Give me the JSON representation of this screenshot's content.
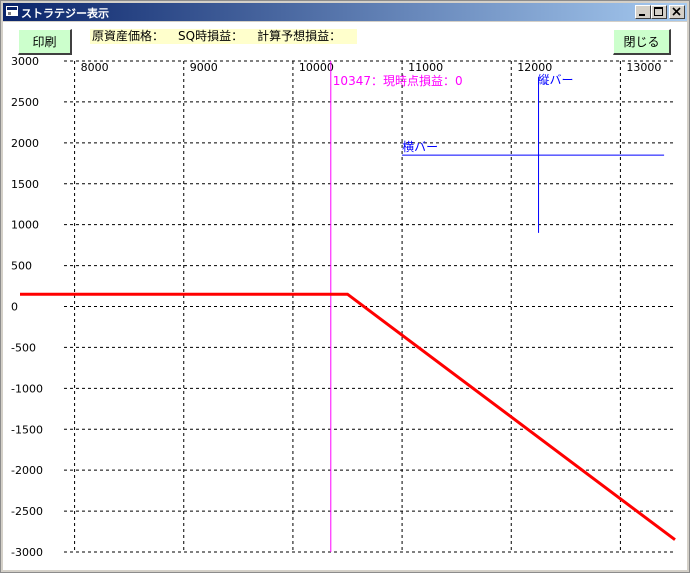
{
  "window": {
    "title": "ストラテジー表示"
  },
  "toolbar": {
    "print_label": "印刷",
    "close_label": "閉じる"
  },
  "info": {
    "underlying_price_label": "原資産価格：",
    "sq_pl_label": "SQ時損益：",
    "calc_expected_pl_label": "計算予想損益："
  },
  "annotations": {
    "current_pl": "10347：現時点損益：0",
    "vertical_bar_label": "縦バー",
    "horizontal_bar_label": "横バー"
  },
  "colors": {
    "payoff": "#ff0000",
    "current_line": "#ff00ff",
    "cursor": "#0000ff",
    "button_bg": "#ccffcc",
    "info_bg": "#ffffcc"
  },
  "chart_data": {
    "type": "line",
    "title": "",
    "xlabel": "",
    "ylabel": "",
    "xlim": [
      7500,
      13500
    ],
    "ylim": [
      -3000,
      3000
    ],
    "grid": true,
    "x_ticks": [
      8000,
      9000,
      10000,
      11000,
      12000,
      13000
    ],
    "y_ticks": [
      3000,
      2500,
      2000,
      1500,
      1000,
      500,
      0,
      -500,
      -1000,
      -1500,
      -2000,
      -2500,
      -3000
    ],
    "series": [
      {
        "x": [
          7500,
          10500,
          13500
        ],
        "y": [
          150,
          150,
          -2850
        ]
      }
    ],
    "current_price_line": 10347,
    "crosshair": {
      "x": 12250,
      "y": 1850,
      "x_range": [
        11500,
        12050
      ],
      "h_range": [
        11000,
        13400
      ]
    }
  }
}
